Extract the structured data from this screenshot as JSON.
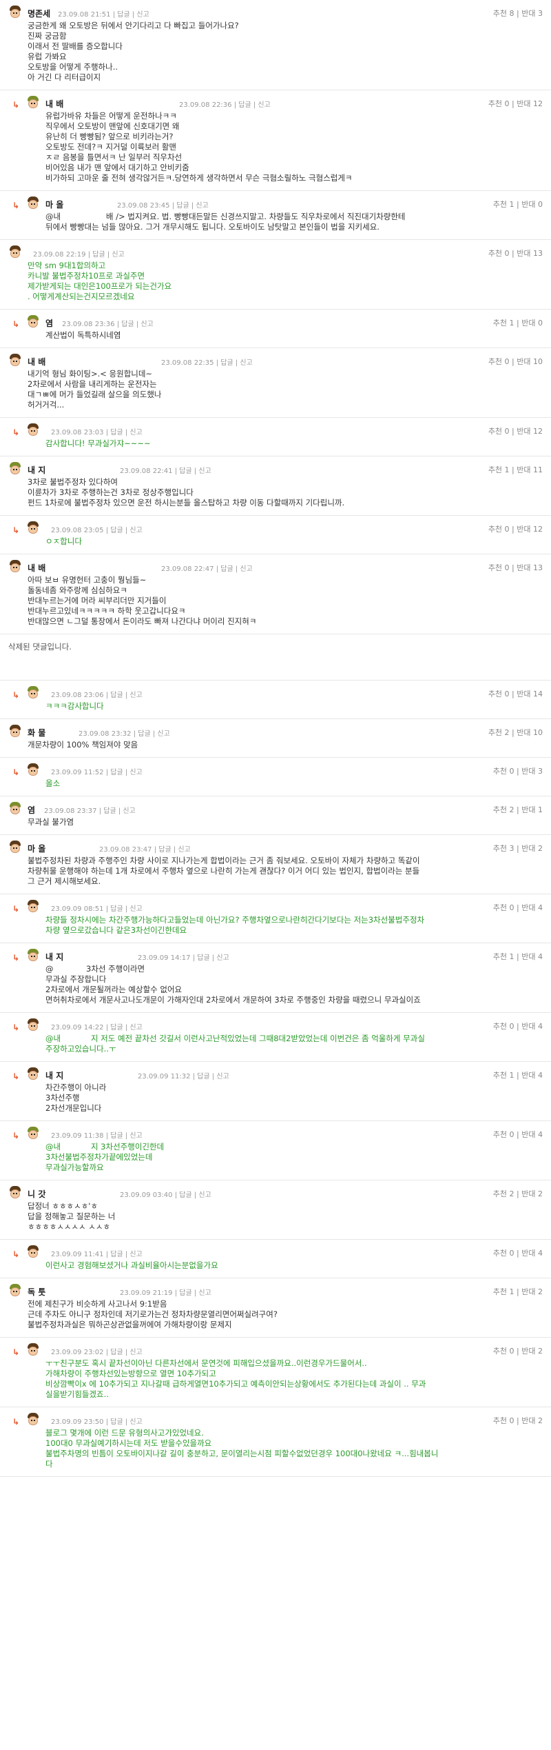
{
  "comments": [
    {
      "id": "c1",
      "reply": false,
      "nick": "명존세",
      "date": "23.09.08 21:51",
      "reply_label": "답글",
      "report_label": "신고",
      "likes": "추천 8",
      "dislikes": "반대 3",
      "text": "궁금한게 왜 오토방은 뒤에서 안기다리고 다 빠집고 들어가나요?\n진짜 궁금함\n이래서 전 딸배를 증오합니다\n유럽 가봐요\n오토방을 어떻게 주행하나..\n아 거긴 다 리터급이지",
      "green": false
    },
    {
      "id": "c2",
      "reply": true,
      "nick": "내                배",
      "date": "23.09.08 22:36",
      "reply_label": "답글",
      "report_label": "신고",
      "likes": "추천 0",
      "dislikes": "반대 12",
      "text": "유럽가바유 차들은 어떻게 운전하나ㅋㅋ\n직우에서 오토방이 맨앞에 신호대기면 왜\n유난히 더 빵빵됨? 앞으로 비키라는거?\n오토방도 전데?ㅋ 지거덜 이륙보러 활맨\nㅈㄹ 음봉을 틀면서ㅋ 난 일부러 직우차선\n비어있음 내가 맨 앞에서 대기하고 안비키줌\n비가하되 고마운 줄 전혀 생각않거든ㅋ.당연하게 생각하면서 무슨 극혐소릴하노 극혐스럽게ㅋ",
      "green": false
    },
    {
      "id": "c3",
      "reply": true,
      "nick": "마       올",
      "date": "23.09.08 23:45",
      "reply_label": "답글",
      "report_label": "신고",
      "likes": "추천 1",
      "dislikes": "반대 0",
      "text": "@내                  배 /> 법지켜요. 법. 빵빵대든말든 신경쓰지말고. 차량들도 직우차로에서 직진대기차량한테\n뒤에서 빵빵대는 넘들 많아요. 그거 개무시해도 됩니다. 오토바이도 남탓말고 본인들이 법을 지키세요.",
      "green": false
    },
    {
      "id": "c4",
      "reply": false,
      "nick": "",
      "date": "23.09.08 22:19",
      "reply_label": "답글",
      "report_label": "신고",
      "likes": "추천 0",
      "dislikes": "반대 13",
      "text": "만약 sm 9대1합의하고\n카니발 불법주정차10프로 과실주면\n제가받게되는 대인은100프로가 되는건가요\n. 어떻게계산되는건지모르겠네요",
      "green": true
    },
    {
      "id": "c5",
      "reply": true,
      "nick": "염",
      "date": "23.09.08 23:36",
      "reply_label": "답글",
      "report_label": "신고",
      "likes": "추천 1",
      "dislikes": "반대 0",
      "text": "계산법이 독특하시네염",
      "green": false
    },
    {
      "id": "c6",
      "reply": false,
      "nick": "내                배",
      "date": "23.09.08 22:35",
      "reply_label": "답글",
      "report_label": "신고",
      "likes": "추천 0",
      "dislikes": "반대 10",
      "text": "내기억 형님 화이팅>.< 응원합니데~\n2차로에서 사람을 내리게하는 운전자는\n대ㄱㅃ에 머가 들었길래 살으을 의도했나\n허거거걱...",
      "green": false
    },
    {
      "id": "c7",
      "reply": true,
      "nick": "",
      "date": "23.09.08 23:03",
      "reply_label": "답글",
      "report_label": "신고",
      "likes": "추천 0",
      "dislikes": "반대 12",
      "text": "감사합니다! 무과실가쟈~~~~",
      "green": true
    },
    {
      "id": "c8",
      "reply": false,
      "nick": "내          지",
      "date": "23.09.08 22:41",
      "reply_label": "답글",
      "report_label": "신고",
      "likes": "추천 1",
      "dislikes": "반대 11",
      "text": "3차로 불법주정차 있다하여\n이륜차가 3차로 주행하는건 3차로 정상주행입니다\n펀드 1차로에 불법주정차 있으면 운전 하시는분들 올스탑하고 차량 이동 다할때까지 기다립니까.",
      "green": false
    },
    {
      "id": "c9",
      "reply": true,
      "nick": "",
      "date": "23.09.08 23:05",
      "reply_label": "답글",
      "report_label": "신고",
      "likes": "추천 0",
      "dislikes": "반대 12",
      "text": "ㅇㅈ합니다",
      "green": true
    },
    {
      "id": "c10",
      "reply": false,
      "nick": "내                배",
      "date": "23.09.08 22:47",
      "reply_label": "답글",
      "report_label": "신고",
      "likes": "추천 0",
      "dislikes": "반대 13",
      "text": "아따 보ㅂ 유명헌터 고충이 뭥님들~\n돌동네좀 와주랑께 심심하요ㅋ\n반대누르는거에 머라 씨부리더만 지거들이\n반대누르고있네ㅋㅋㅋㅋㅋ 하학 웃고갑니다요ㅋ\n반대많으면 ㄴ그덜 통장에서 돈이라도 빠져 나간다냐 머이리 진지혀ㅋ",
      "green": false
    },
    {
      "id": "c12",
      "reply": true,
      "nick": "",
      "date": "23.09.08 23:06",
      "reply_label": "답글",
      "report_label": "신고",
      "likes": "추천 0",
      "dislikes": "반대 14",
      "text": "ㅋㅋㅋ감사합니다",
      "green": true
    },
    {
      "id": "c13",
      "reply": false,
      "nick": "화    물",
      "date": "23.09.08 23:32",
      "reply_label": "답글",
      "report_label": "신고",
      "likes": "추천 2",
      "dislikes": "반대 10",
      "text": "개문차량이 100% 책임져야 맞음",
      "green": false
    },
    {
      "id": "c14",
      "reply": true,
      "nick": "",
      "date": "23.09.09 11:52",
      "reply_label": "답글",
      "report_label": "신고",
      "likes": "추천 0",
      "dislikes": "반대 3",
      "text": "올소",
      "green": true
    },
    {
      "id": "c15",
      "reply": false,
      "nick": "염",
      "date": "23.09.08 23:37",
      "reply_label": "답글",
      "report_label": "신고",
      "likes": "추천 2",
      "dislikes": "반대 1",
      "text": "무과실 불가염",
      "green": false
    },
    {
      "id": "c16",
      "reply": false,
      "nick": "마       올",
      "date": "23.09.08 23:47",
      "reply_label": "답글",
      "report_label": "신고",
      "likes": "추천 3",
      "dislikes": "반대 2",
      "text": "불법주정차된 차량과 주행주인 차량 사이로 지나가는게 합법이라는 근거 좀 줘보세요. 오토바이 자체가 차량하고 똑같이\n차량취물 운행해야 하는데 1개 차로에서 주행차 옆으로 나란히 가는게 괜찮다? 이거 어디 있는 법인지, 합법이라는 분들\n그 근거 제시해보세요.",
      "green": false
    },
    {
      "id": "c17",
      "reply": true,
      "nick": "",
      "date": "23.09.09 08:51",
      "reply_label": "답글",
      "report_label": "신고",
      "likes": "추천 0",
      "dislikes": "반대 4",
      "text": "차량들 정차시에는 차간주행가능하다고들었는데 아닌가요? 주행차옆으로나란히간다기보다는 저는3차선불법주정차\n차량 옆으로갔습니다 같은3차선이긴한데요",
      "green": true
    },
    {
      "id": "c18",
      "reply": true,
      "nick": "내          지",
      "date": "23.09.09 14:17",
      "reply_label": "답글",
      "report_label": "신고",
      "likes": "추천 1",
      "dislikes": "반대 4",
      "text": "@             3차선 주행이라면\n무과실 주장합니다\n2차로에서 개문될꺼라는 예상할수 없어요\n면허취차로에서 개문사고나도개문이 가해자인대 2차로에서 개문하여 3차로 주행중인 차량을 때렸으니 무과실이죠",
      "green": false
    },
    {
      "id": "c19",
      "reply": true,
      "nick": "",
      "date": "23.09.09 14:22",
      "reply_label": "답글",
      "report_label": "신고",
      "likes": "추천 0",
      "dislikes": "반대 4",
      "text": "@내            지 저도 예전 끝차선 갓길서 이런사고난적있었는데 그때8대2받았었는데 이번건은 좀 억울하게 무과실\n주장하고있습니다..ㅜ",
      "green": true
    },
    {
      "id": "c20",
      "reply": true,
      "nick": "내          지",
      "date": "23.09.09 11:32",
      "reply_label": "답글",
      "report_label": "신고",
      "likes": "추천 1",
      "dislikes": "반대 4",
      "text": "차간주행이 아니라\n3차선주행\n2차선개문입니다",
      "green": false
    },
    {
      "id": "c21",
      "reply": true,
      "nick": "",
      "date": "23.09.09 11:38",
      "reply_label": "답글",
      "report_label": "신고",
      "likes": "추천 0",
      "dislikes": "반대 4",
      "text": "@내            지 3차선주행이긴한데\n3차선불법주정차가끝에있었는데\n무과실가능할까요",
      "green": true
    },
    {
      "id": "c22",
      "reply": false,
      "nick": "니          갓",
      "date": "23.09.09 03:40",
      "reply_label": "답글",
      "report_label": "신고",
      "likes": "추천 2",
      "dislikes": "반대 2",
      "text": "답정너 ㅎㅎㅎㅅㅎ'ㅎ\n답을 정해놓고 질문하는 너\nㅎㅎㅎㅎㅅㅅㅅㅅ ㅅㅅㅎ",
      "green": false
    },
    {
      "id": "c23",
      "reply": true,
      "nick": "",
      "date": "23.09.09 11:41",
      "reply_label": "답글",
      "report_label": "신고",
      "likes": "추천 0",
      "dislikes": "반대 4",
      "text": "이런사고 경험해보셨거나 과실비율아시는분없을가요",
      "green": true
    },
    {
      "id": "c24",
      "reply": false,
      "nick": "독          툿",
      "date": "23.09.09 21:19",
      "reply_label": "답글",
      "report_label": "신고",
      "likes": "추천 1",
      "dislikes": "반대 2",
      "text": "전에 제친구가 비슷하게 사고나서 9:1받음\n근데 주차도 아니구 정차인데 저기로가는건 정차차량문열리면어쩌실려구여?\n불법주정차과실은 뭐하곤상관없을꺼에여 가해차량이랑 문제지",
      "green": false
    },
    {
      "id": "c25",
      "reply": true,
      "nick": "",
      "date": "23.09.09 23:02",
      "reply_label": "답글",
      "report_label": "신고",
      "likes": "추천 0",
      "dislikes": "반대 2",
      "text": "ㅜㅜ친구분도 혹시 끝차선이아닌 다른차선에서 문연것에 피해입으셨을까요..이런경우가드물어서..\n가해차량이 주행차선있는방향으로 열면 10추가되고\n비상깜빡이x 에 10추가되고 지나갈때 급하게열면10추가되고 예측이안되는상황에서도 추가된다는데 과실이 .. 무과\n실을받기힘들겠죠..",
      "green": true
    },
    {
      "id": "c26",
      "reply": true,
      "nick": "",
      "date": "23.09.09 23:50",
      "reply_label": "답글",
      "report_label": "신고",
      "likes": "추천 0",
      "dislikes": "반대 2",
      "text": "블로그 몇개에 이런 드문 유형의사고가있었네요.\n100대0 무과실예기하시는데 저도 받을수있을까요\n불법주차명의 빈틈이 오토바이지나갈 길이 충분하고, 문이열리는시점 피할수없었던경우 100대0나왔네요 ㅋ...힘내봅니\n다",
      "green": true
    }
  ],
  "deleted": {
    "text": "삭제된 댓글입니다."
  }
}
